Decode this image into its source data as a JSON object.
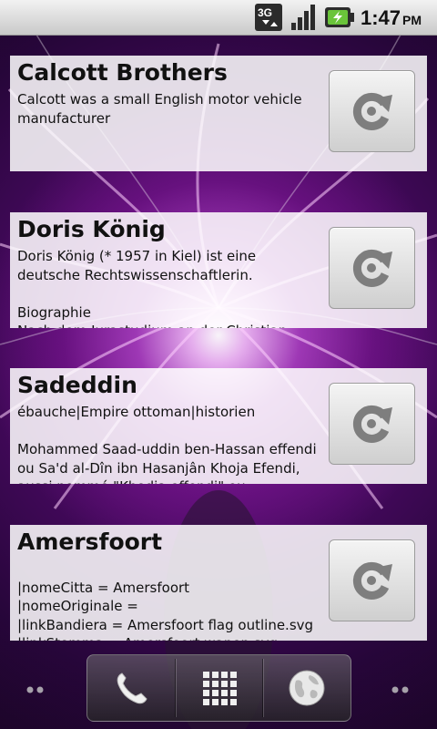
{
  "status_bar": {
    "network_type": "3G",
    "time": "1:47",
    "ampm": "PM",
    "icons": [
      "3g-data-icon",
      "signal-strength-icon",
      "battery-charging-icon"
    ]
  },
  "widgets": [
    {
      "title": "Calcott Brothers",
      "body": "Calcott was a small English motor vehicle manufacturer",
      "refresh_icon": "refresh-icon"
    },
    {
      "title": "Doris König",
      "body": "Doris König (* 1957 in Kiel) ist eine deutsche Rechtswissenschaftlerin.\n\nBiographie\nNach dem Jurastudium an der Christian",
      "refresh_icon": "refresh-icon"
    },
    {
      "title": "Sadeddin",
      "body": "ébauche|Empire ottoman|historien\n\nMohammed Saad-uddin ben-Hassan effendi ou Sa'd al-Dîn ibn Hasanjân Khoja Efendi, aussi nommé \"Khodja effendi\" ou",
      "refresh_icon": "refresh-icon"
    },
    {
      "title": "Amersfoort",
      "body": "\n|nomeCitta = Amersfoort\n|nomeOriginale =\n|linkBandiera = Amersfoort flag outline.svg\n|linkStemma = Amersfoort wapen.svg",
      "refresh_icon": "refresh-icon"
    }
  ],
  "dock": {
    "items": [
      "phone-icon",
      "app-drawer-icon",
      "browser-globe-icon"
    ]
  },
  "colors": {
    "widget_bg": "#ffffffdb",
    "status_bar_bg": "#dcdcdc",
    "battery_green": "#6ac43a"
  }
}
